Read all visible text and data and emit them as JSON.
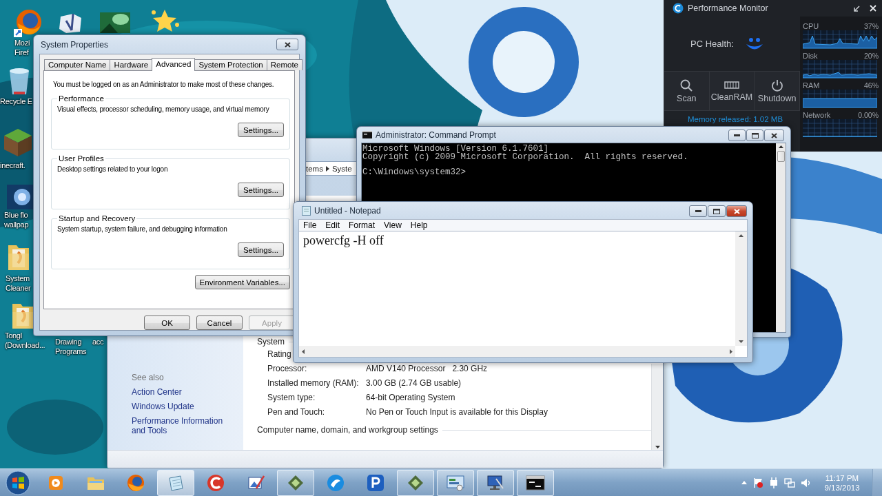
{
  "desktop": {
    "icons": [
      {
        "kind": "firefox",
        "label": [
          "Mozi",
          "Firef"
        ]
      },
      {
        "kind": "recycle",
        "label": [
          "Recycle E"
        ]
      },
      {
        "kind": "minecraft",
        "label": [
          "inecraft."
        ]
      },
      {
        "kind": "orb",
        "label": [
          "Blue flo",
          "wallpap"
        ]
      },
      {
        "kind": "folder",
        "label": [
          "System",
          "Cleaner"
        ]
      },
      {
        "kind": "folder",
        "label": [
          "Tongl",
          "(Download..."
        ]
      },
      {
        "kind": "lambda"
      },
      {
        "kind": "landscape"
      },
      {
        "kind": "star"
      },
      {
        "kind": "covered",
        "label": [
          "Drawing",
          "Programs"
        ]
      },
      {
        "kind": "covered",
        "label": [
          "acc"
        ]
      }
    ]
  },
  "control_panel": {
    "breadcrumb": [
      "tems",
      "Syste"
    ],
    "see_also": "See also",
    "links": [
      "Action Center",
      "Windows Update",
      "Performance Information and Tools"
    ],
    "section": "System",
    "rating_label": "Rating",
    "specs": [
      {
        "label": "Processor:",
        "value": "AMD V140 Processor   2.30 GHz"
      },
      {
        "label": "Installed memory (RAM):",
        "value": "3.00 GB (2.74 GB usable)"
      },
      {
        "label": "System type:",
        "value": "64-bit Operating System"
      },
      {
        "label": "Pen and Touch:",
        "value": "No Pen or Touch Input is available for this Display"
      }
    ],
    "section2": "Computer name, domain, and workgroup settings"
  },
  "system_properties": {
    "title": "System Properties",
    "tabs": [
      {
        "label": "Computer Name",
        "selected": false
      },
      {
        "label": "Hardware",
        "selected": false
      },
      {
        "label": "Advanced",
        "selected": true
      },
      {
        "label": "System Protection",
        "selected": false
      },
      {
        "label": "Remote",
        "selected": false
      }
    ],
    "notice": "You must be logged on as an Administrator to make most of these changes.",
    "groups": [
      {
        "title": "Performance",
        "description": "Visual effects, processor scheduling, memory usage, and virtual memory",
        "button": "Settings..."
      },
      {
        "title": "User Profiles",
        "description": "Desktop settings related to your logon",
        "button": "Settings..."
      },
      {
        "title": "Startup and Recovery",
        "description": "System startup, system failure, and debugging information",
        "button": "Settings..."
      }
    ],
    "env_button": "Environment Variables...",
    "buttons": [
      {
        "label": "OK",
        "disabled": false
      },
      {
        "label": "Cancel",
        "disabled": false
      },
      {
        "label": "Apply",
        "disabled": true
      }
    ]
  },
  "command_prompt": {
    "title": "Administrator: Command Prompt",
    "lines": [
      "Microsoft Windows [Version 6.1.7601]",
      "Copyright (c) 2009 Microsoft Corporation.  All rights reserved."
    ],
    "prompt": "C:\\Windows\\system32>"
  },
  "notepad": {
    "title": "Untitled - Notepad",
    "menu": [
      "File",
      "Edit",
      "Format",
      "View",
      "Help"
    ],
    "text": "powercfg -H off"
  },
  "performance_monitor": {
    "title": "Performance Monitor",
    "health_label": "PC Health:",
    "actions": [
      {
        "kind": "scan",
        "label": "Scan"
      },
      {
        "kind": "ram",
        "label": "CleanRAM"
      },
      {
        "kind": "power",
        "label": "Shutdown"
      }
    ],
    "status": "Memory released: 1.02 MB",
    "meters": [
      {
        "kind": "spiky",
        "name": "CPU",
        "reading": "37%"
      },
      {
        "kind": "low",
        "name": "Disk",
        "reading": "20%"
      },
      {
        "kind": "band",
        "name": "RAM",
        "reading": "46%"
      },
      {
        "kind": "flat",
        "name": "Network",
        "reading": "0.00%"
      }
    ]
  },
  "taskbar": {
    "items": [
      {
        "kind": "media",
        "open": false,
        "selected": false
      },
      {
        "kind": "explorer",
        "open": false,
        "selected": false
      },
      {
        "kind": "firefox",
        "open": false,
        "selected": false
      },
      {
        "kind": "notepad",
        "open": true,
        "selected": true
      },
      {
        "kind": "ccleaner",
        "open": false,
        "selected": false
      },
      {
        "kind": "paint",
        "open": false,
        "selected": false
      },
      {
        "kind": "game",
        "open": true,
        "selected": false
      },
      {
        "kind": "globe",
        "open": false,
        "selected": false
      },
      {
        "kind": "app",
        "open": false,
        "selected": false
      },
      {
        "kind": "game",
        "open": true,
        "selected": false
      },
      {
        "kind": "panel",
        "open": true,
        "selected": false
      },
      {
        "kind": "system",
        "open": true,
        "selected": false
      },
      {
        "kind": "cmd",
        "open": true,
        "selected": false
      }
    ],
    "time": "11:17 PM",
    "date": "9/13/2013"
  }
}
